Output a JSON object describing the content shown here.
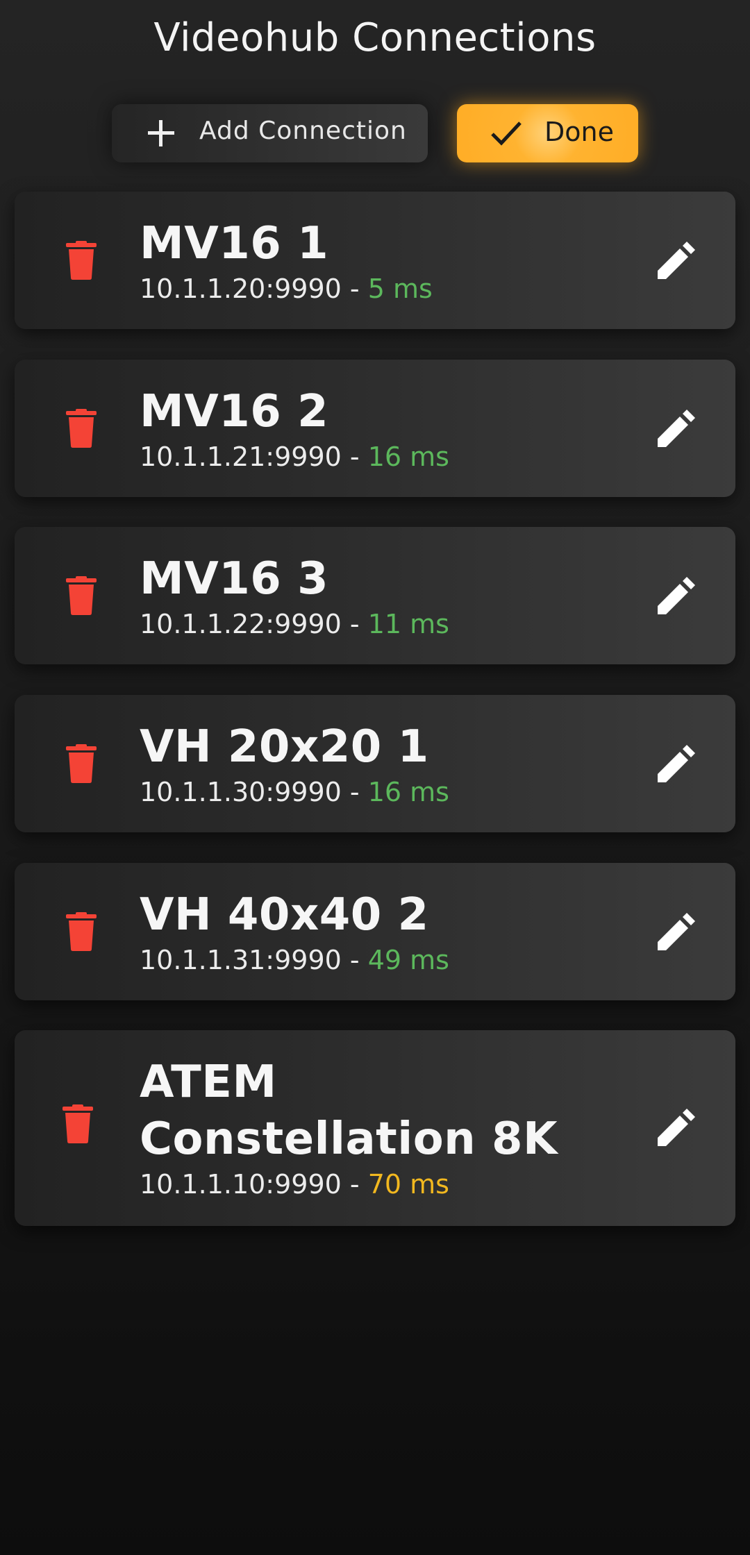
{
  "header": {
    "title": "Videohub Connections"
  },
  "toolbar": {
    "add_label": "Add Connection",
    "add_icon": "plus-icon",
    "done_label": "Done",
    "done_icon": "check-icon",
    "done_color": "#ffb330"
  },
  "connections": [
    {
      "name": "MV16 1",
      "address": "10.1.1.20:9990",
      "separator": " - ",
      "latency": "5 ms",
      "latency_status": "good"
    },
    {
      "name": "MV16 2",
      "address": "10.1.1.21:9990",
      "separator": " - ",
      "latency": "16 ms",
      "latency_status": "good"
    },
    {
      "name": "MV16 3",
      "address": "10.1.1.22:9990",
      "separator": " - ",
      "latency": "11 ms",
      "latency_status": "good"
    },
    {
      "name": "VH 20x20 1",
      "address": "10.1.1.30:9990",
      "separator": " - ",
      "latency": "16 ms",
      "latency_status": "good"
    },
    {
      "name": "VH 40x40 2",
      "address": "10.1.1.31:9990",
      "separator": " - ",
      "latency": "49 ms",
      "latency_status": "good"
    },
    {
      "name": "ATEM Constellation 8K",
      "address": "10.1.1.10:9990",
      "separator": " - ",
      "latency": "70 ms",
      "latency_status": "warn"
    }
  ],
  "icons": {
    "delete": "trash-icon",
    "edit": "pencil-icon"
  },
  "colors": {
    "delete": "#f44336",
    "latency_good": "#5cb85c",
    "latency_warn": "#f2b81f",
    "accent": "#ffb330"
  }
}
